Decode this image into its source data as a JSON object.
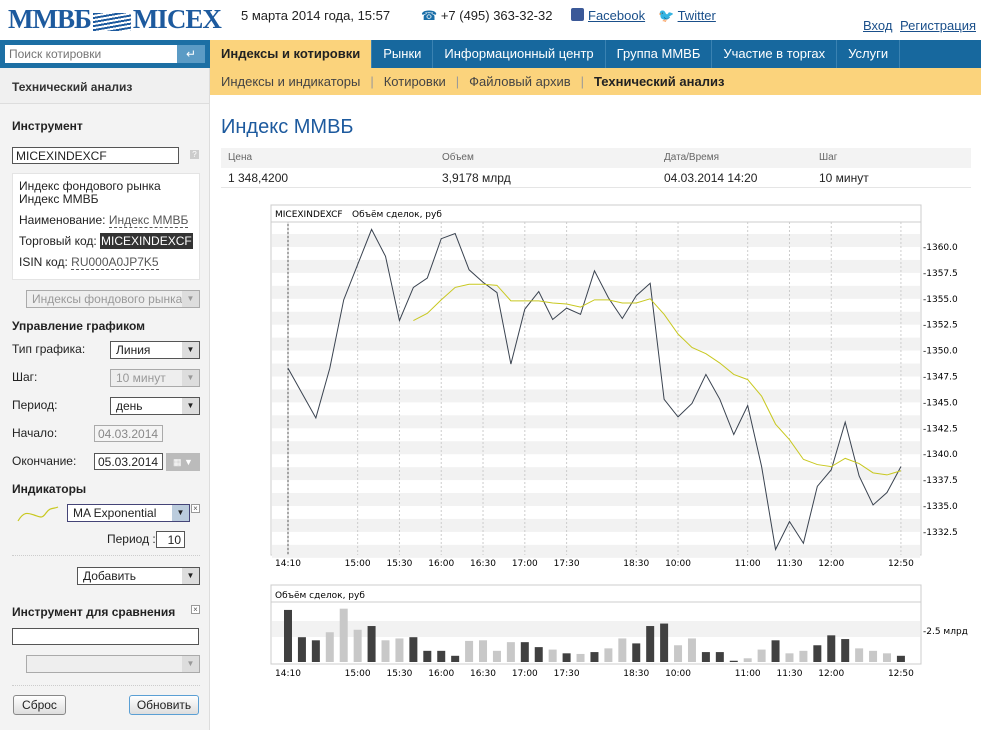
{
  "header": {
    "logo": "ММВБ MICEX",
    "date": "5 марта 2014 года, 15:57",
    "phone": "+7 (495) 363-32-32",
    "facebook": "Facebook",
    "twitter": "Twitter",
    "login": "Вход",
    "register": "Регистрация"
  },
  "search": {
    "placeholder": "Поиск котировки",
    "go_icon": "enter-icon"
  },
  "nav": [
    "Индексы и котировки",
    "Рынки",
    "Информационный центр",
    "Группа ММВБ",
    "Участие в торгах",
    "Услуги"
  ],
  "subnav": [
    "Индексы и индикаторы",
    "Котировки",
    "Файловый архив",
    "Технический анализ"
  ],
  "left": {
    "title": "Технический анализ",
    "instrument_h": "Инструмент",
    "instrument_value": "MICEXINDEXCF",
    "info_desc": "Индекс фондового рынка Индекс ММВБ",
    "name_label": "Наименование:",
    "name_value": "Индекс ММВБ",
    "code_label": "Торговый код:",
    "code_value": "MICEXINDEXCF",
    "isin_label": "ISIN код:",
    "isin_value": "RU000A0JP7K5",
    "group_select": "Индексы фондового рынка",
    "control_h": "Управление графиком",
    "type_label": "Тип графика:",
    "type_value": "Линия",
    "step_label": "Шаг:",
    "step_value": "10 минут",
    "period_label": "Период:",
    "period_value": "день",
    "start_label": "Начало:",
    "start_value": "04.03.2014",
    "end_label": "Окончание:",
    "end_value": "05.03.2014",
    "indicators_h": "Индикаторы",
    "indicator_value": "MA Exponential",
    "ind_period_label": "Период :",
    "ind_period_value": "10",
    "add_select": "Добавить",
    "compare_h": "Инструмент для сравнения",
    "compare_value": "",
    "reset": "Сброс",
    "update": "Обновить"
  },
  "main": {
    "title": "Индекс ММВБ",
    "table": {
      "headers": [
        "Цена",
        "Объем",
        "Дата/Время",
        "Шаг"
      ],
      "values": [
        "1 348,4200",
        "3,9178 млрд",
        "04.03.2014 14:20",
        "10 минут"
      ]
    }
  },
  "colors": {
    "price": "#3a4350",
    "ma": "#c8c820",
    "vol_dark": "#404040",
    "vol_light": "#c8c8c8",
    "accent": "#17689e"
  },
  "chart_data": [
    {
      "type": "line",
      "title": "MICEXINDEXCF",
      "subtitle": "Объём сделок, руб",
      "ylim": [
        1330,
        1362
      ],
      "yticks": [
        1360.0,
        1357.5,
        1355.0,
        1352.5,
        1350.0,
        1347.5,
        1345.0,
        1342.5,
        1340.0,
        1337.5,
        1335.0,
        1332.5
      ],
      "xticks": [
        {
          "i": 0,
          "label": "14:10"
        },
        {
          "i": 5,
          "label": "15:00"
        },
        {
          "i": 8,
          "label": "15:30"
        },
        {
          "i": 11,
          "label": "16:00"
        },
        {
          "i": 14,
          "label": "16:30"
        },
        {
          "i": 17,
          "label": "17:00"
        },
        {
          "i": 20,
          "label": "17:30"
        },
        {
          "i": 25,
          "label": "18:30"
        },
        {
          "i": 28,
          "label": "10:00"
        },
        {
          "i": 33,
          "label": "11:00"
        },
        {
          "i": 36,
          "label": "11:30"
        },
        {
          "i": 39,
          "label": "12:00"
        },
        {
          "i": 44,
          "label": "12:50"
        }
      ],
      "series": [
        {
          "name": "MICEXINDEXCF",
          "values": [
            1348.3,
            1345.9,
            1343.5,
            1348.3,
            1354.9,
            1358.3,
            1361.7,
            1359.1,
            1352.9,
            1356.1,
            1357.0,
            1360.8,
            1361.3,
            1357.8,
            1356.6,
            1355.6,
            1348.7,
            1354.0,
            1355.7,
            1353.0,
            1354.1,
            1353.5,
            1357.7,
            1355.1,
            1353.1,
            1355.3,
            1356.5,
            1345.3,
            1343.6,
            1344.9,
            1347.7,
            1345.3,
            1341.9,
            1344.7,
            1338.8,
            1330.8,
            1333.5,
            1331.4,
            1336.9,
            1338.5,
            1343.1,
            1337.9,
            1335.1,
            1336.3,
            1338.8
          ]
        },
        {
          "name": "MA Exponential",
          "start": 9,
          "values": [
            1352.9,
            1353.6,
            1354.9,
            1356.1,
            1356.4,
            1356.4,
            1356.3,
            1354.8,
            1354.8,
            1354.8,
            1354.6,
            1354.5,
            1354.2,
            1354.9,
            1354.9,
            1354.6,
            1354.6,
            1355.0,
            1353.5,
            1351.6,
            1350.3,
            1349.7,
            1348.8,
            1347.7,
            1347.2,
            1345.6,
            1342.9,
            1341.4,
            1339.5,
            1339.0,
            1338.8,
            1339.6,
            1339.1,
            1338.2,
            1338.0,
            1338.4
          ]
        }
      ]
    },
    {
      "type": "bar",
      "title": "Объём сделок, руб",
      "unit": "млрд",
      "ytick": {
        "value": 2.5,
        "label": "2.5 млрд"
      },
      "values": [
        4.2,
        2.0,
        1.75,
        2.4,
        4.3,
        2.6,
        2.9,
        1.75,
        1.9,
        2.0,
        0.9,
        0.9,
        0.5,
        1.7,
        1.75,
        0.9,
        1.6,
        1.6,
        1.2,
        1.0,
        0.7,
        0.65,
        0.8,
        1.1,
        1.9,
        1.5,
        2.9,
        3.1,
        1.35,
        1.9,
        0.8,
        0.8,
        0.1,
        0.3,
        1.0,
        1.75,
        0.7,
        0.9,
        1.35,
        2.15,
        1.85,
        1.1,
        0.9,
        0.7,
        0.5
      ],
      "shade": "dddllldllddddllllddldldlldddlldddlldlldddllldd"
    }
  ]
}
